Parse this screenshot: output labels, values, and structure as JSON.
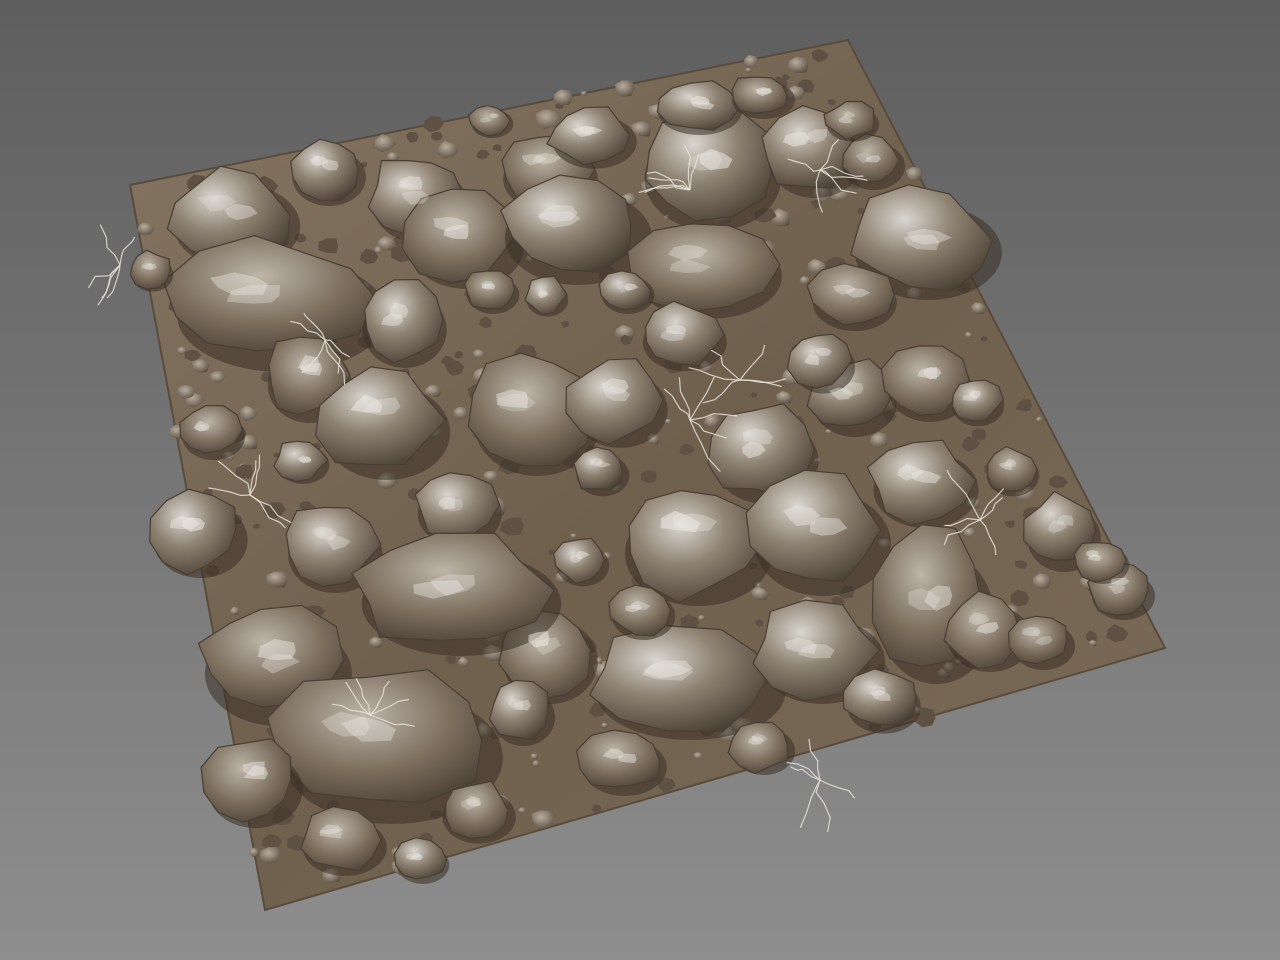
{
  "scene": {
    "background_top": "#5e5e5e",
    "background_bottom": "#8e8e8e",
    "ground_color": "#7a6a56",
    "soil_dark": "#4e4236",
    "rock_base": "#8f8373",
    "rock_light": "#d9d6d0",
    "rock_dark": "#4a3f34",
    "root_color": "#e8e2d8"
  }
}
